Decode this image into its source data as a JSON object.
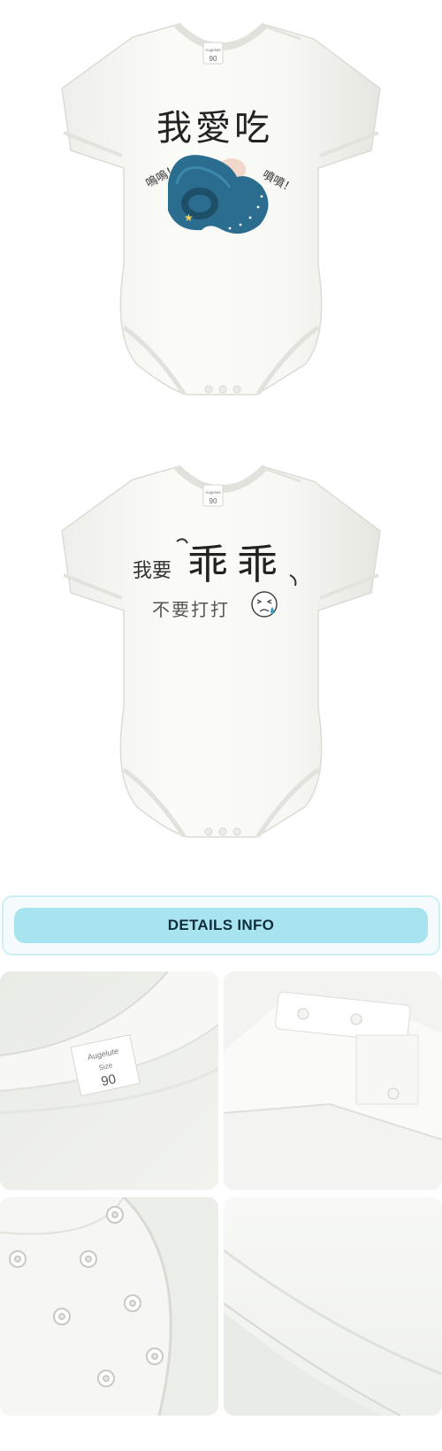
{
  "products": [
    {
      "label": {
        "brand": "Augelute",
        "size": "90"
      },
      "print": {
        "title": "我愛吃",
        "left_sound": "嗚嗚！",
        "right_sound": "噴噴！"
      }
    },
    {
      "label": {
        "brand": "Augelute",
        "size": "90"
      },
      "print": {
        "prefix": "我要",
        "big": "乖乖",
        "subtitle": "不要打打"
      }
    }
  ],
  "details": {
    "title": "DETAILS INFO",
    "tag": {
      "brand": "Augelute",
      "size_word": "Size",
      "size": "90"
    }
  },
  "colors": {
    "garment": "#f7f7f2",
    "details_pill": "#a8e4f0",
    "details_border": "#cdeff6",
    "pacifier_blue": "#2a6d8f"
  },
  "icons": {
    "product_1": "pacifier-icon",
    "product_2": "crying-face-icon"
  }
}
